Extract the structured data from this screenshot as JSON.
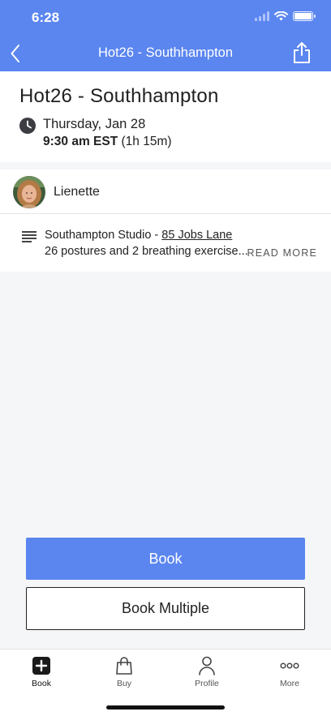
{
  "status_bar": {
    "time": "6:28"
  },
  "nav": {
    "title": "Hot26 - Southhampton",
    "back_icon": "chevron-left-icon",
    "share_icon": "share-icon"
  },
  "class_info": {
    "title": "Hot26 - Southhampton",
    "date": "Thursday, Jan 28",
    "time": "9:30 am EST",
    "duration": "(1h 15m)"
  },
  "instructor": {
    "name": "Lienette"
  },
  "description": {
    "location": "Southampton Studio - ",
    "address": "85 Jobs Lane",
    "summary": "26 postures and 2 breathing exercise...",
    "read_more": "READ MORE"
  },
  "actions": {
    "book": "Book",
    "book_multiple": "Book Multiple"
  },
  "tabbar": {
    "items": [
      {
        "label": "Book",
        "icon": "plus-square-icon",
        "active": true
      },
      {
        "label": "Buy",
        "icon": "shopping-bag-icon",
        "active": false
      },
      {
        "label": "Profile",
        "icon": "person-icon",
        "active": false
      },
      {
        "label": "More",
        "icon": "more-dots-icon",
        "active": false
      }
    ]
  },
  "colors": {
    "accent": "#5b86f0",
    "background": "#f5f6f8"
  }
}
